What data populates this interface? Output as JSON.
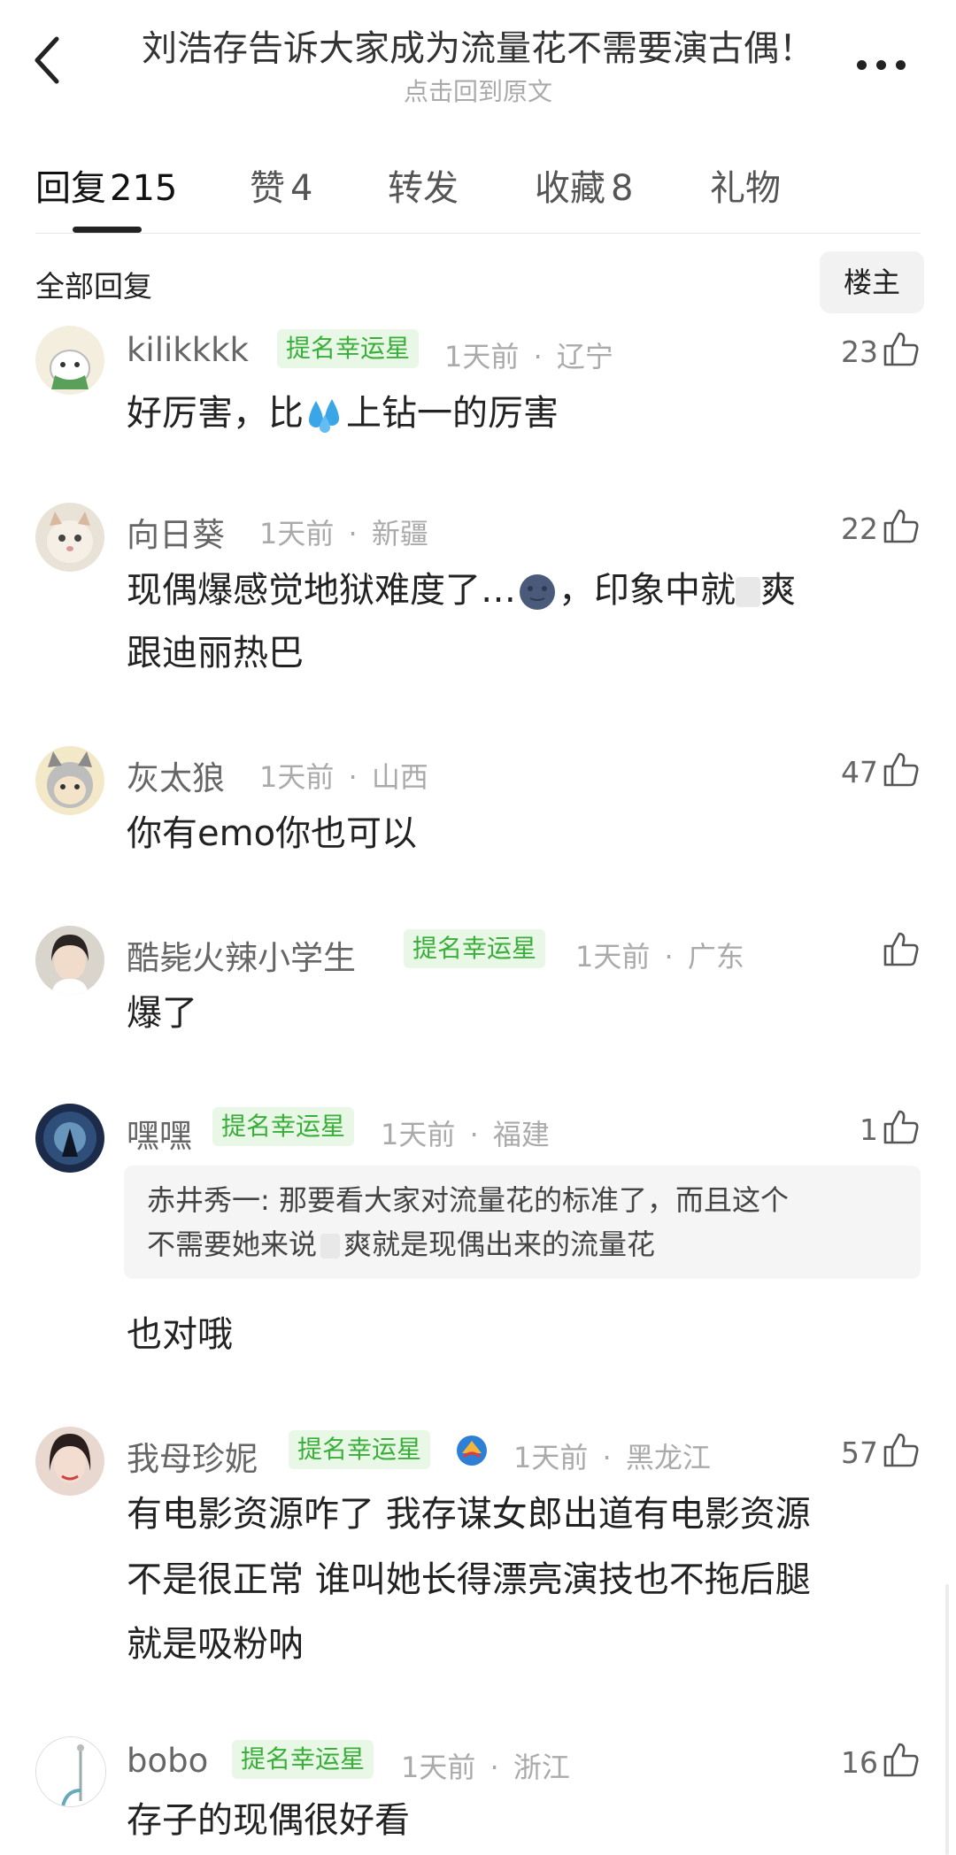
{
  "header": {
    "title": "刘浩存告诉大家成为流量花不需要演古偶！",
    "subtitle": "点击回到原文",
    "back_icon": "chevron-left-icon",
    "more_icon": "more-dots-icon"
  },
  "tabs": [
    {
      "label": "回复",
      "count": "215",
      "active": true
    },
    {
      "label": "赞",
      "count": "4",
      "active": false
    },
    {
      "label": "转发",
      "count": "",
      "active": false
    },
    {
      "label": "收藏",
      "count": "8",
      "active": false
    },
    {
      "label": "礼物",
      "count": "",
      "active": false
    }
  ],
  "section": {
    "title": "全部回复",
    "filter_button": "楼主"
  },
  "comments": [
    {
      "name": "kilikkkk",
      "badge": "提名幸运星",
      "time": "1天前",
      "location": "辽宁",
      "likes": "23",
      "text_before": "好厉害，比",
      "text_emoji": "sweat-droplets-emoji",
      "text_after": "上钻一的厉害"
    },
    {
      "name": "向日葵",
      "time": "1天前",
      "location": "新疆",
      "likes": "22",
      "line1_before": "现偶爆感觉地狱难度了…",
      "line1_emoji": "moon-face-emoji",
      "line1_after": "，印象中就",
      "line1_end": "爽",
      "line2": "跟迪丽热巴"
    },
    {
      "name": "灰太狼",
      "time": "1天前",
      "location": "山西",
      "likes": "47",
      "text": "你有emo你也可以"
    },
    {
      "name": "酷毙火辣小学生",
      "badge": "提名幸运星",
      "time": "1天前",
      "location": "广东",
      "likes": "",
      "text": "爆了"
    },
    {
      "name": "嘿嘿",
      "badge": "提名幸运星",
      "time": "1天前",
      "location": "福建",
      "likes": "1",
      "quote_line1": "赤井秀一: 那要看大家对流量花的标准了，而且这个",
      "quote_line2_before": "不需要她来说",
      "quote_line2_after": "爽就是现偶出来的流量花",
      "text": "也对哦"
    },
    {
      "name": "我母珍妮",
      "badge": "提名幸运星",
      "time": "1天前",
      "location": "黑龙江",
      "likes": "57",
      "lines": [
        "有电影资源咋了 我存谋女郎出道有电影资源",
        "不是很正常 谁叫她长得漂亮演技也不拖后腿",
        "就是吸粉呐"
      ]
    },
    {
      "name": "bobo",
      "badge": "提名幸运星",
      "time": "1天前",
      "location": "浙江",
      "likes": "16",
      "text": "存子的现偶很好看"
    }
  ],
  "separator": "·",
  "colors": {
    "badge_bg": "#e9f8e6",
    "badge_text": "#3aae3a",
    "muted": "#aaaaaa"
  }
}
